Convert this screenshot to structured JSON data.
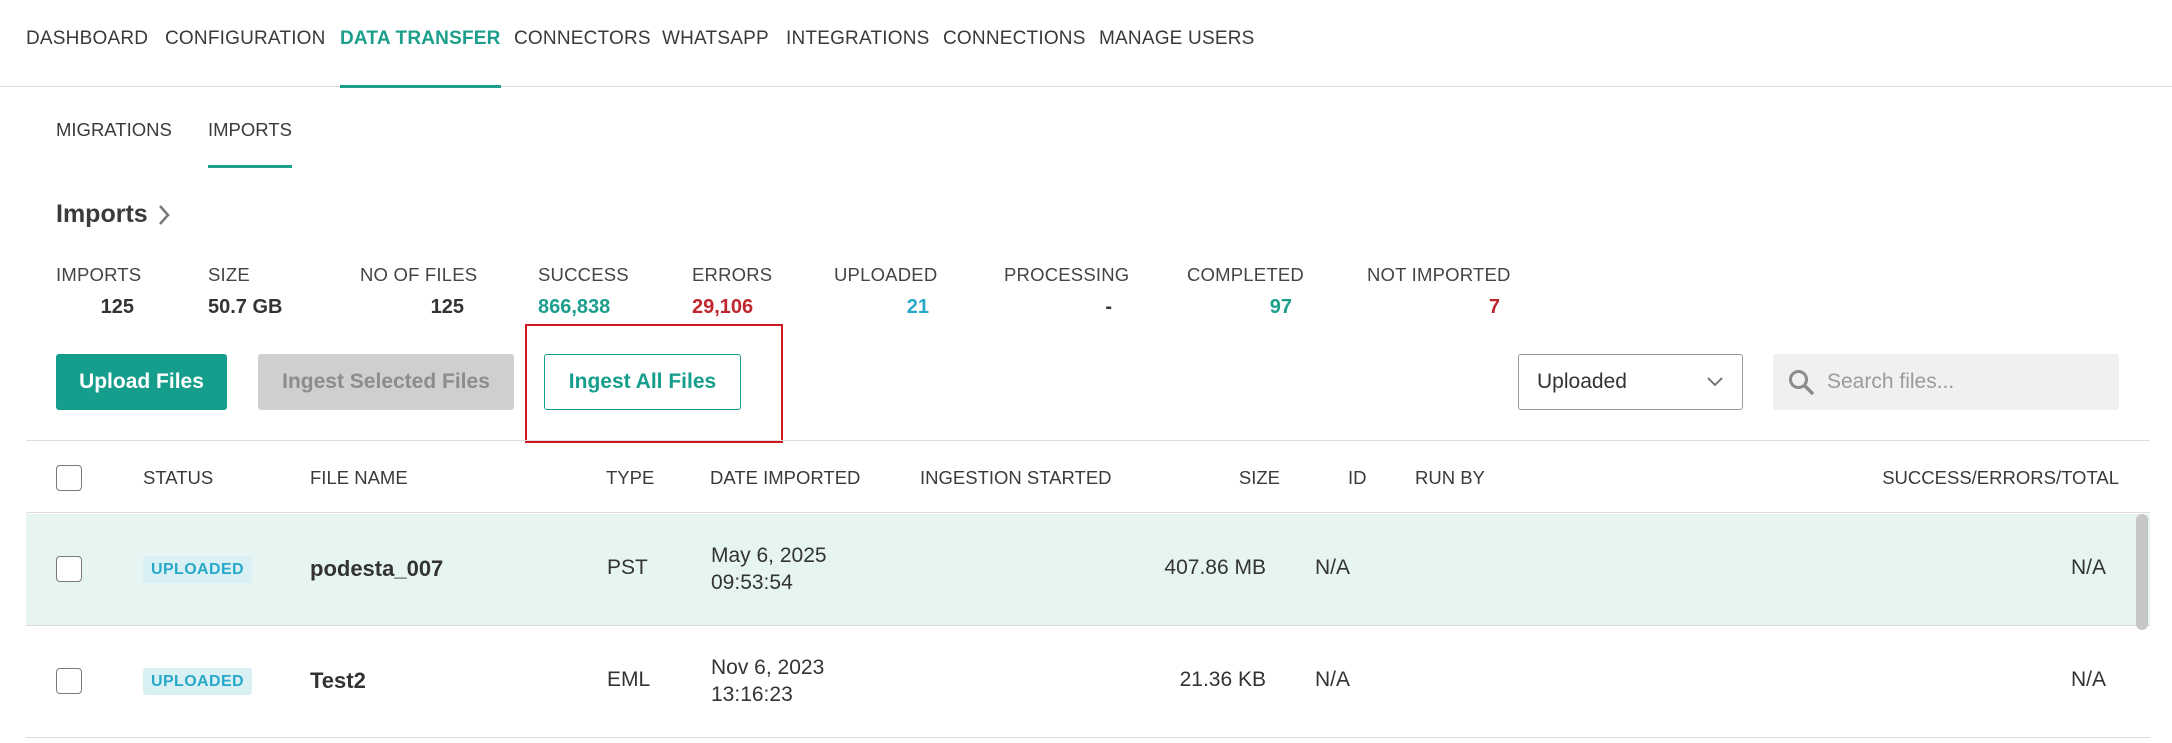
{
  "top_nav": [
    {
      "label": "DASHBOARD"
    },
    {
      "label": "CONFIGURATION"
    },
    {
      "label": "DATA TRANSFER"
    },
    {
      "label": "CONNECTORS"
    },
    {
      "label": "WHATSAPP"
    },
    {
      "label": "INTEGRATIONS"
    },
    {
      "label": "CONNECTIONS"
    },
    {
      "label": "MANAGE USERS"
    }
  ],
  "active_top_tab": "DATA TRANSFER",
  "sub_tabs": [
    {
      "label": "MIGRATIONS"
    },
    {
      "label": "IMPORTS"
    }
  ],
  "active_sub_tab": "IMPORTS",
  "page_title": "Imports",
  "stats": [
    {
      "label": "IMPORTS",
      "value": "125"
    },
    {
      "label": "SIZE",
      "value": "50.7 GB"
    },
    {
      "label": "NO OF FILES",
      "value": "125"
    },
    {
      "label": "SUCCESS",
      "value": "866,838"
    },
    {
      "label": "ERRORS",
      "value": "29,106"
    },
    {
      "label": "UPLOADED",
      "value": "21"
    },
    {
      "label": "PROCESSING",
      "value": "-"
    },
    {
      "label": "COMPLETED",
      "value": "97"
    },
    {
      "label": "NOT IMPORTED",
      "value": "7"
    }
  ],
  "buttons": {
    "upload": "Upload Files",
    "ingest_selected": "Ingest Selected Files",
    "ingest_all": "Ingest All Files"
  },
  "filter": {
    "selected": "Uploaded"
  },
  "search": {
    "placeholder": "Search files..."
  },
  "table": {
    "columns": [
      "STATUS",
      "FILE NAME",
      "TYPE",
      "DATE IMPORTED",
      "INGESTION STARTED",
      "SIZE",
      "ID",
      "RUN BY",
      "SUCCESS/ERRORS/TOTAL"
    ],
    "rows": [
      {
        "status": "UPLOADED",
        "file_name": "podesta_007",
        "type": "PST",
        "date": "May 6, 2025",
        "time": "09:53:54",
        "ingestion_started": "",
        "size": "407.86 MB",
        "id": "N/A",
        "run_by": "",
        "totals": "N/A"
      },
      {
        "status": "UPLOADED",
        "file_name": "Test2",
        "type": "EML",
        "date": "Nov 6, 2023",
        "time": "13:16:23",
        "ingestion_started": "",
        "size": "21.36 KB",
        "id": "N/A",
        "run_by": "",
        "totals": "N/A"
      }
    ]
  },
  "colors": {
    "accent": "#169e8c",
    "error": "#c0262d",
    "info": "#2aa8c9",
    "highlight": "#d0161f"
  }
}
